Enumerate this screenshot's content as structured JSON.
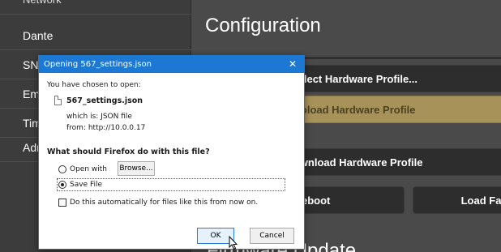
{
  "sidebar": {
    "items": [
      {
        "label": "Network"
      },
      {
        "label": "Dante"
      },
      {
        "label": "SNM"
      },
      {
        "label": "Ema"
      },
      {
        "label": "Tim"
      },
      {
        "label": "Adn"
      }
    ]
  },
  "main": {
    "title": "Configuration",
    "select_profile": "Select Hardware Profile...",
    "upload_profile": "Upload Hardware Profile",
    "download_profile": "Download Hardware Profile",
    "reboot": "eboot",
    "load_factory": "Load Fact",
    "firmware_title": "Firmware Update"
  },
  "dialog": {
    "title": "Opening 567_settings.json",
    "close_glyph": "✕",
    "intro": "You have chosen to open:",
    "filename": "567_settings.json",
    "which_is": "which is: JSON file",
    "from": "from: http://10.0.0.17",
    "question": "What should Firefox do with this file?",
    "open_with_label": "Open with",
    "browse_label": "Browse...",
    "save_file_label": "Save File",
    "auto_label": "Do this automatically for files like this from now on.",
    "ok_label": "OK",
    "cancel_label": "Cancel",
    "selected_option": "save_file"
  },
  "colors": {
    "titlebar": "#1c78d3",
    "upload_button": "#a7925a",
    "app_background": "#4a4a4a"
  }
}
